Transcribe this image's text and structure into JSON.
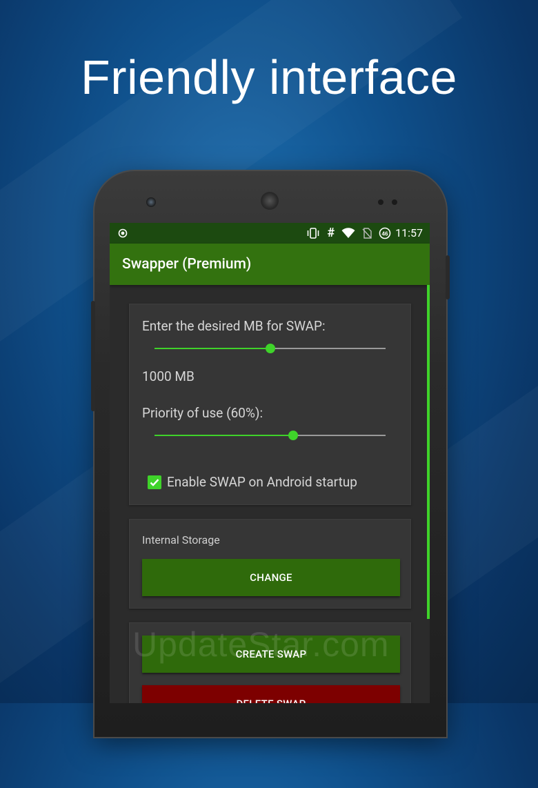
{
  "promo": {
    "headline": "Friendly interface"
  },
  "statusbar": {
    "time": "11:57",
    "hash_glyph": "#"
  },
  "appbar": {
    "title": "Swapper (Premium)"
  },
  "swap_settings": {
    "mb_label": "Enter the desired MB for SWAP:",
    "mb_slider_fraction": 0.5,
    "mb_value": "1000 MB",
    "priority_label": "Priority of use (60%):",
    "priority_slider_fraction": 0.6,
    "startup_checkbox_label": "Enable SWAP on Android startup",
    "startup_checked": true
  },
  "storage": {
    "location_label": "Internal Storage",
    "change_button": "CHANGE"
  },
  "actions": {
    "create_button": "CREATE SWAP",
    "delete_button": "DELETE SWAP"
  },
  "watermark": "UpdateStar.com",
  "colors": {
    "accent_green": "#3fd32a",
    "appbar_green": "#33720f",
    "button_green": "#2f6a0b",
    "delete_red": "#7d0000"
  }
}
